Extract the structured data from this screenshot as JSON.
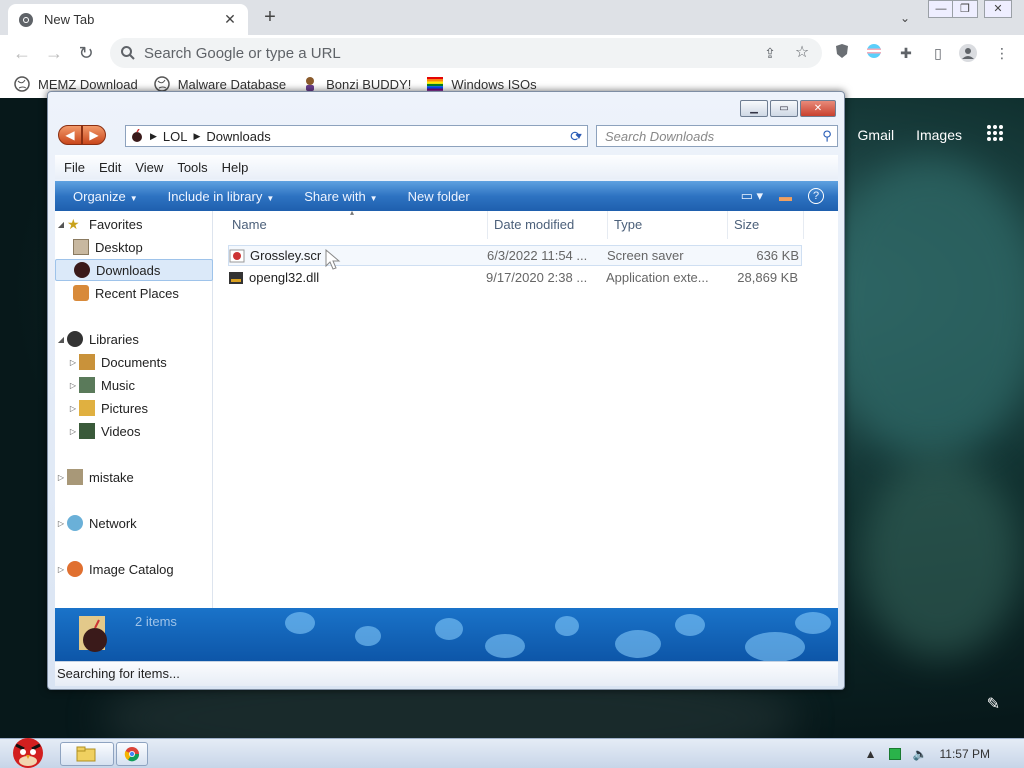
{
  "chrome": {
    "tab_title": "New Tab",
    "tab_close": "✕",
    "new_tab": "+",
    "omnibox_placeholder": "Search Google or type a URL",
    "bookmarks": [
      {
        "label": "MEMZ Download"
      },
      {
        "label": "Malware Database"
      },
      {
        "label": "Bonzi BUDDY!"
      },
      {
        "label": "Windows ISOs"
      }
    ]
  },
  "google": {
    "gmail": "Gmail",
    "images": "Images"
  },
  "explorer": {
    "breadcrumb": [
      "LOL",
      "Downloads"
    ],
    "search_placeholder": "Search Downloads",
    "menu": [
      "File",
      "Edit",
      "View",
      "Tools",
      "Help"
    ],
    "commands": [
      "Organize",
      "Include in library",
      "Share with",
      "New folder"
    ],
    "nav": {
      "favorites": "Favorites",
      "desktop": "Desktop",
      "downloads": "Downloads",
      "recent": "Recent Places",
      "libraries": "Libraries",
      "documents": "Documents",
      "music": "Music",
      "pictures": "Pictures",
      "videos": "Videos",
      "mistake": "mistake",
      "network": "Network",
      "image_catalog": "Image Catalog"
    },
    "columns": {
      "name": "Name",
      "date": "Date modified",
      "type": "Type",
      "size": "Size"
    },
    "files": [
      {
        "name": "Grossley.scr",
        "date": "6/3/2022 11:54 ...",
        "type": "Screen saver",
        "size": "636 KB"
      },
      {
        "name": "opengl32.dll",
        "date": "9/17/2020 2:38 ...",
        "type": "Application exte...",
        "size": "28,869 KB"
      }
    ],
    "item_count": "2 items",
    "status": "Searching for items..."
  },
  "taskbar": {
    "clock": "11:57 PM"
  },
  "colors": {
    "cmdbar": "#2e73c2",
    "close_button": "#c8412e",
    "selection": "#dbe9f9"
  }
}
